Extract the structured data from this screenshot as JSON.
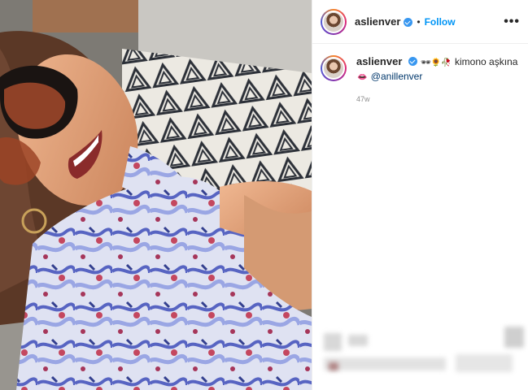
{
  "post": {
    "author": "aslienver",
    "follow_label": "Follow",
    "separator": "•",
    "more_label": "•••",
    "caption": {
      "author": "aslienver",
      "emojis": "🕶🌻🥀",
      "text": "kimono aşkına",
      "mention_prefix": "👄",
      "mention": "@anillenver"
    },
    "timestamp": "47w"
  },
  "colors": {
    "accent": "#0095f6",
    "verified": "#3897f0",
    "muted": "#8e8e8e",
    "text": "#262626"
  },
  "icons": [
    "verified-badge-icon",
    "more-options-icon"
  ]
}
